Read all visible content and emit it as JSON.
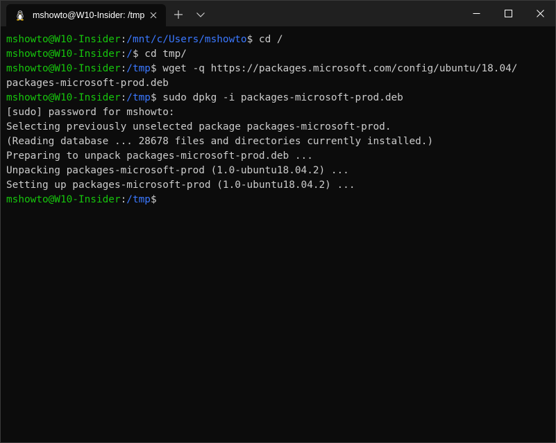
{
  "window": {
    "tab_title": "mshowto@W10-Insider: /tmp",
    "icons": {
      "tab": "linux-penguin-icon",
      "tab_close": "close-icon",
      "new_tab": "plus-icon",
      "dropdown": "chevron-down-icon",
      "minimize": "minimize-icon",
      "maximize": "maximize-icon",
      "close": "close-icon"
    }
  },
  "colors": {
    "user": "#16c60c",
    "path": "#3b78ff",
    "text": "#cccccc",
    "background": "#0c0c0c",
    "titlebar": "#202020"
  },
  "terminal": {
    "lines": [
      {
        "user": "mshowto@W10-Insider",
        "sep": ":",
        "path": "/mnt/c/Users/mshowto",
        "rest": "$ cd /"
      },
      {
        "user": "mshowto@W10-Insider",
        "sep": ":",
        "path": "/",
        "rest": "$ cd tmp/"
      },
      {
        "user": "mshowto@W10-Insider",
        "sep": ":",
        "path": "/tmp",
        "rest": "$ wget -q https://packages.microsoft.com/config/ubuntu/18.04/"
      },
      {
        "text": "packages-microsoft-prod.deb"
      },
      {
        "user": "mshowto@W10-Insider",
        "sep": ":",
        "path": "/tmp",
        "rest": "$ sudo dpkg -i packages-microsoft-prod.deb"
      },
      {
        "text": "[sudo] password for mshowto:"
      },
      {
        "text": "Selecting previously unselected package packages-microsoft-prod."
      },
      {
        "text": "(Reading database ... 28678 files and directories currently installed.)"
      },
      {
        "text": "Preparing to unpack packages-microsoft-prod.deb ..."
      },
      {
        "text": "Unpacking packages-microsoft-prod (1.0-ubuntu18.04.2) ..."
      },
      {
        "text": "Setting up packages-microsoft-prod (1.0-ubuntu18.04.2) ..."
      },
      {
        "user": "mshowto@W10-Insider",
        "sep": ":",
        "path": "/tmp",
        "rest": "$"
      }
    ]
  }
}
